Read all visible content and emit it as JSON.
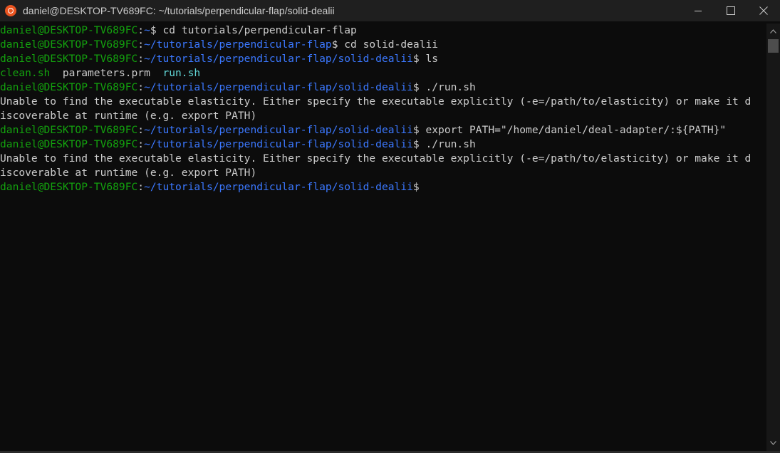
{
  "window": {
    "title": "daniel@DESKTOP-TV689FC: ~/tutorials/perpendicular-flap/solid-dealii",
    "icon": "ubuntu-icon",
    "controls": [
      "minimize-icon",
      "maximize-icon",
      "close-icon"
    ]
  },
  "colors": {
    "prompt_user": "#13a10e",
    "prompt_path": "#3b78ff",
    "text": "#cccccc",
    "executable": "#61d6d6",
    "background": "#0c0c0c"
  },
  "terminal": {
    "lines": [
      {
        "segments": [
          {
            "text": "daniel@DESKTOP-TV689FC",
            "style": "green"
          },
          {
            "text": ":",
            "style": "white"
          },
          {
            "text": "~",
            "style": "blue"
          },
          {
            "text": "$ cd tutorials/perpendicular-flap",
            "style": "white"
          }
        ]
      },
      {
        "segments": [
          {
            "text": "daniel@DESKTOP-TV689FC",
            "style": "green"
          },
          {
            "text": ":",
            "style": "white"
          },
          {
            "text": "~/tutorials/perpendicular-flap",
            "style": "blue"
          },
          {
            "text": "$ cd solid-dealii",
            "style": "white"
          }
        ]
      },
      {
        "segments": [
          {
            "text": "daniel@DESKTOP-TV689FC",
            "style": "green"
          },
          {
            "text": ":",
            "style": "white"
          },
          {
            "text": "~/tutorials/perpendicular-flap/solid-dealii",
            "style": "blue"
          },
          {
            "text": "$ ls",
            "style": "white"
          }
        ]
      },
      {
        "segments": [
          {
            "text": "clean.sh",
            "style": "green"
          },
          {
            "text": "  parameters.prm  ",
            "style": "white"
          },
          {
            "text": "run.sh",
            "style": "teal"
          }
        ]
      },
      {
        "segments": [
          {
            "text": "daniel@DESKTOP-TV689FC",
            "style": "green"
          },
          {
            "text": ":",
            "style": "white"
          },
          {
            "text": "~/tutorials/perpendicular-flap/solid-dealii",
            "style": "blue"
          },
          {
            "text": "$ ./run.sh",
            "style": "white"
          }
        ]
      },
      {
        "segments": [
          {
            "text": "Unable to find the executable elasticity. Either specify the executable explicitly (-e=/path/to/elasticity) or make it d",
            "style": "white"
          }
        ]
      },
      {
        "segments": [
          {
            "text": "iscoverable at runtime (e.g. export PATH)",
            "style": "white"
          }
        ]
      },
      {
        "segments": [
          {
            "text": "daniel@DESKTOP-TV689FC",
            "style": "green"
          },
          {
            "text": ":",
            "style": "white"
          },
          {
            "text": "~/tutorials/perpendicular-flap/solid-dealii",
            "style": "blue"
          },
          {
            "text": "$ export PATH=\"/home/daniel/deal-adapter/:${PATH}\"",
            "style": "white"
          }
        ]
      },
      {
        "segments": [
          {
            "text": "daniel@DESKTOP-TV689FC",
            "style": "green"
          },
          {
            "text": ":",
            "style": "white"
          },
          {
            "text": "~/tutorials/perpendicular-flap/solid-dealii",
            "style": "blue"
          },
          {
            "text": "$ ./run.sh",
            "style": "white"
          }
        ]
      },
      {
        "segments": [
          {
            "text": "Unable to find the executable elasticity. Either specify the executable explicitly (-e=/path/to/elasticity) or make it d",
            "style": "white"
          }
        ]
      },
      {
        "segments": [
          {
            "text": "iscoverable at runtime (e.g. export PATH)",
            "style": "white"
          }
        ]
      },
      {
        "segments": [
          {
            "text": "daniel@DESKTOP-TV689FC",
            "style": "green"
          },
          {
            "text": ":",
            "style": "white"
          },
          {
            "text": "~/tutorials/perpendicular-flap/solid-dealii",
            "style": "blue"
          },
          {
            "text": "$",
            "style": "white"
          }
        ]
      }
    ]
  }
}
